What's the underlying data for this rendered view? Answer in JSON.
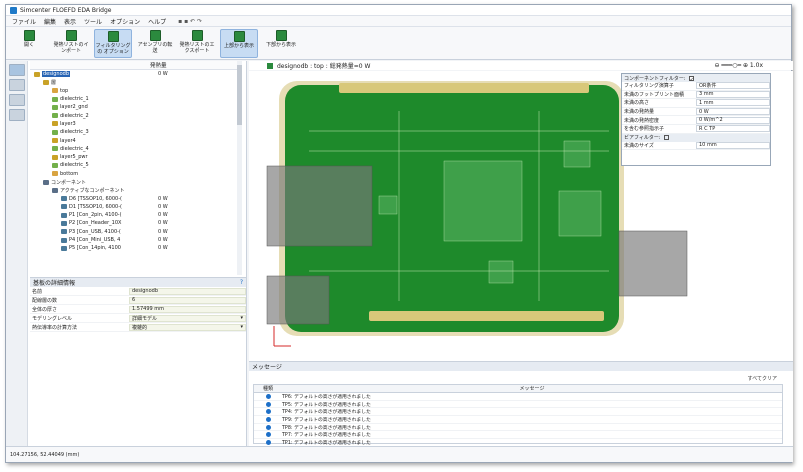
{
  "window": {
    "title": "Simcenter FLOEFD EDA Bridge"
  },
  "menu": [
    "ファイル",
    "編集",
    "表示",
    "ツール",
    "オプション",
    "ヘルプ"
  ],
  "ribbon": [
    {
      "label": "開く"
    },
    {
      "label": "発熱リストのイ ンポート"
    },
    {
      "label": "フィルタリングの オプション"
    },
    {
      "label": "アセンブリの転 送"
    },
    {
      "label": "発熱リストのエ クスポート"
    },
    {
      "label": "上部から表示"
    },
    {
      "label": "下部から表示"
    }
  ],
  "tree": {
    "col2": "発熱量",
    "rows": [
      {
        "label": "designodb",
        "val": "0 W",
        "indent": 0,
        "sel": true
      },
      {
        "label": "層",
        "val": "",
        "indent": 1
      },
      {
        "label": "top",
        "val": "",
        "indent": 2
      },
      {
        "label": "dielectric_1",
        "val": "",
        "indent": 2
      },
      {
        "label": "layer2_gnd",
        "val": "",
        "indent": 2
      },
      {
        "label": "dielectric_2",
        "val": "",
        "indent": 2
      },
      {
        "label": "layer3",
        "val": "",
        "indent": 2
      },
      {
        "label": "dielectric_3",
        "val": "",
        "indent": 2
      },
      {
        "label": "layer4",
        "val": "",
        "indent": 2
      },
      {
        "label": "dielectric_4",
        "val": "",
        "indent": 2
      },
      {
        "label": "layer5_pwr",
        "val": "",
        "indent": 2
      },
      {
        "label": "dielectric_5",
        "val": "",
        "indent": 2
      },
      {
        "label": "bottom",
        "val": "",
        "indent": 2
      },
      {
        "label": "コンポーネント",
        "val": "",
        "indent": 1
      },
      {
        "label": "アクティブなコンポーネント",
        "val": "",
        "indent": 2
      },
      {
        "label": "D6 [TSSOP10, 6000-(",
        "val": "0 W",
        "indent": 3
      },
      {
        "label": "D1 [TSSOP10, 6000-(",
        "val": "0 W",
        "indent": 3
      },
      {
        "label": "P1 [Con_2pin, 4100-(",
        "val": "0 W",
        "indent": 3
      },
      {
        "label": "P2 [Con_Header_10X",
        "val": "0 W",
        "indent": 3
      },
      {
        "label": "P3 [Con_USB, 4100-(",
        "val": "0 W",
        "indent": 3
      },
      {
        "label": "P4 [Con_Mini_USB, 4",
        "val": "0 W",
        "indent": 3
      },
      {
        "label": "P5 [Con_14pin, 4100",
        "val": "0 W",
        "indent": 3
      }
    ]
  },
  "props": {
    "title": "基板の詳細情報",
    "rows": [
      {
        "k": "名前",
        "v": "designodb",
        "dd": false
      },
      {
        "k": "配線層の数",
        "v": "6",
        "dd": false
      },
      {
        "k": "全体の厚さ",
        "v": "1.57499 mm",
        "dd": false
      },
      {
        "k": "モデリングレベル",
        "v": "詳細モデル",
        "dd": true
      },
      {
        "k": "熱伝導率の計算方法",
        "v": "複雑的",
        "dd": true
      }
    ]
  },
  "view": {
    "header": "designodb : top : 総発熱量=0 W",
    "zoom": "1.0x"
  },
  "filter": {
    "title": "コンポーネントフィルター:",
    "rows": [
      {
        "k": "フィルタリング演算子",
        "v": "OR条件"
      },
      {
        "k": "未満のフットプリント面積",
        "v": "3 mm"
      },
      {
        "k": "未満の高さ",
        "v": "1 mm"
      },
      {
        "k": "未満の発熱量",
        "v": "0 W"
      },
      {
        "k": "未満の発熱密度",
        "v": "0 W/m^2"
      },
      {
        "k": "を含む参照指示子",
        "v": "R C TP"
      }
    ],
    "via_label": "ビアフィルター:",
    "via_row": {
      "k": "未満のサイズ",
      "v": "10 mm"
    }
  },
  "messages": {
    "title": "メッセージ",
    "clear": "すべてクリア",
    "col1": "種類",
    "col2": "メッセージ",
    "rows": [
      "TP6: デフォルトの高さが適用されました",
      "TP5: デフォルトの高さが適用されました",
      "TP4: デフォルトの高さが適用されました",
      "TP9: デフォルトの高さが適用されました",
      "TP8: デフォルトの高さが適用されました",
      "TP7: デフォルトの高さが適用されました",
      "TP1: デフォルトの高さが適用されました"
    ]
  },
  "status": "104.27156, 52.44049 (mm)"
}
